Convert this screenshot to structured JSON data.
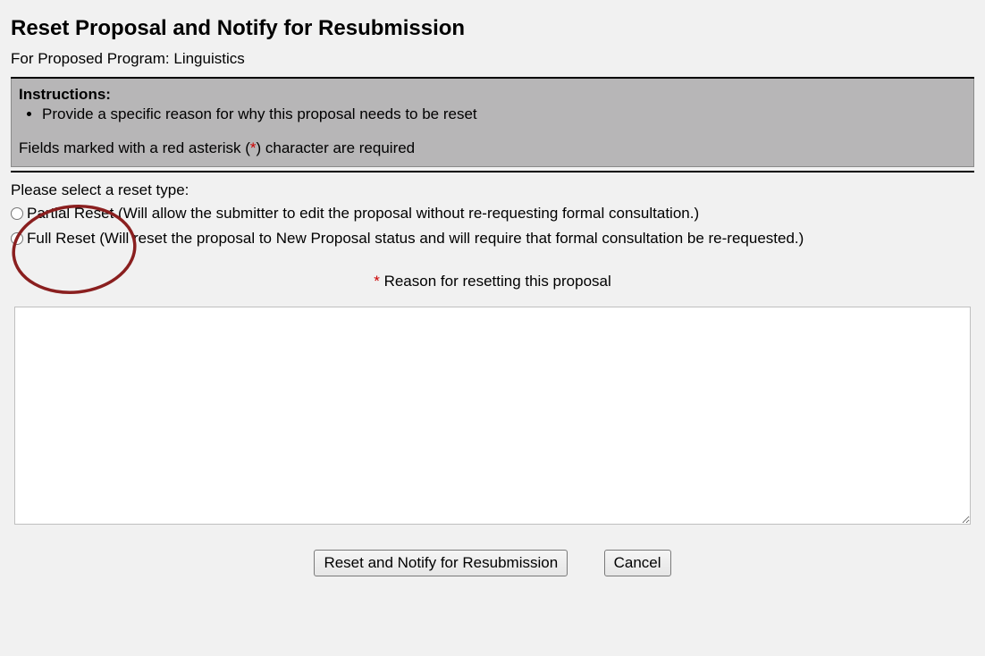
{
  "header": {
    "title": "Reset Proposal and Notify for Resubmission",
    "subtitle_prefix": "For Proposed Program: ",
    "program_name": "Linguistics"
  },
  "instructions": {
    "label": "Instructions:",
    "items": [
      "Provide a specific reason for why this proposal needs to be reset"
    ],
    "required_note_pre": "Fields marked with a red asterisk (",
    "required_note_asterisk": "*",
    "required_note_post": ") character are required"
  },
  "reset_type": {
    "prompt": "Please select a reset type:",
    "options": [
      {
        "label": "Partial Reset (Will allow the submitter to edit the proposal without re-requesting formal consultation.)",
        "value": "partial"
      },
      {
        "label": "Full Reset (Will reset the proposal to New Proposal status and will require that formal consultation be re-requested.)",
        "value": "full"
      }
    ]
  },
  "reason": {
    "asterisk": "*",
    "label": " Reason for resetting this proposal",
    "value": ""
  },
  "buttons": {
    "submit": "Reset and Notify for Resubmission",
    "cancel": "Cancel"
  },
  "annotation": {
    "circle_color": "#8a1f1f"
  }
}
